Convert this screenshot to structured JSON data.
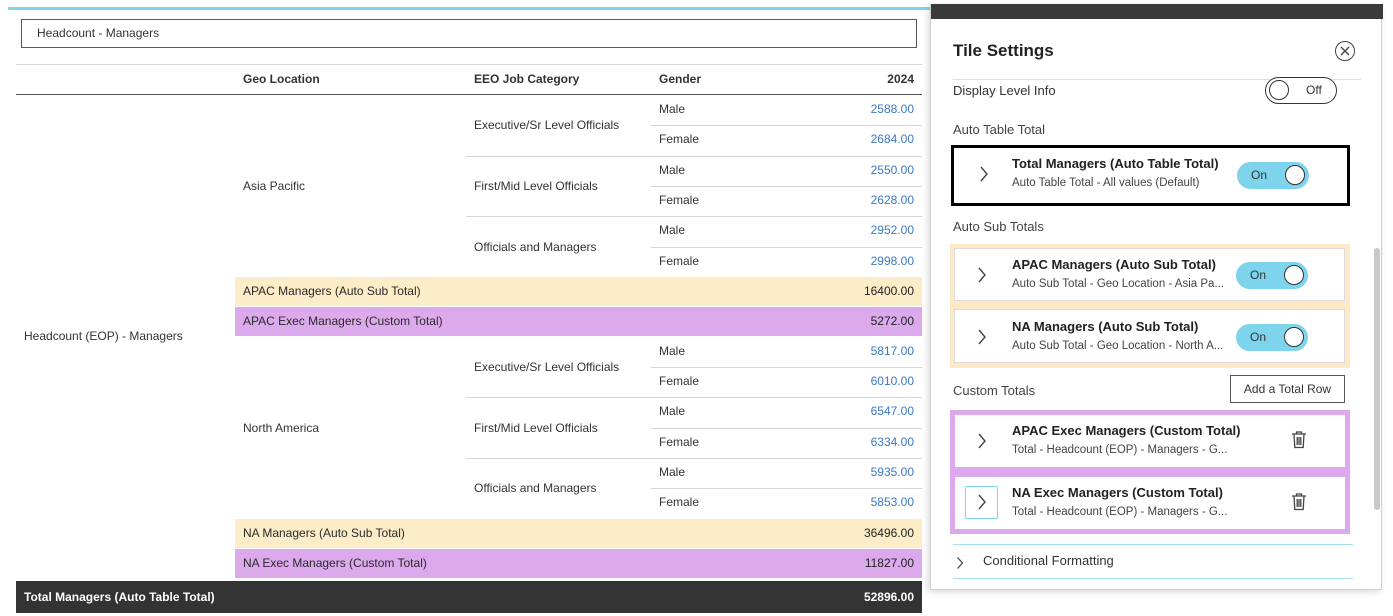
{
  "tile_title": "Headcount - Managers",
  "table": {
    "headers": {
      "geo": "Geo Location",
      "eeo": "EEO Job Category",
      "gender": "Gender",
      "year": "2024"
    },
    "row_group_label": "Headcount (EOP) - Managers",
    "regions": [
      {
        "name": "Asia Pacific",
        "categories": [
          {
            "name": "Executive/Sr Level Officials",
            "rows": [
              {
                "gender": "Male",
                "value": "2588.00"
              },
              {
                "gender": "Female",
                "value": "2684.00"
              }
            ]
          },
          {
            "name": "First/Mid Level Officials",
            "rows": [
              {
                "gender": "Male",
                "value": "2550.00"
              },
              {
                "gender": "Female",
                "value": "2628.00"
              }
            ]
          },
          {
            "name": "Officials and Managers",
            "rows": [
              {
                "gender": "Male",
                "value": "2952.00"
              },
              {
                "gender": "Female",
                "value": "2998.00"
              }
            ]
          }
        ],
        "sub_total": {
          "label": "APAC Managers (Auto Sub Total)",
          "value": "16400.00"
        },
        "custom_total": {
          "label": "APAC Exec Managers (Custom Total)",
          "value": "5272.00"
        }
      },
      {
        "name": "North America",
        "categories": [
          {
            "name": "Executive/Sr Level Officials",
            "rows": [
              {
                "gender": "Male",
                "value": "5817.00"
              },
              {
                "gender": "Female",
                "value": "6010.00"
              }
            ]
          },
          {
            "name": "First/Mid Level Officials",
            "rows": [
              {
                "gender": "Male",
                "value": "6547.00"
              },
              {
                "gender": "Female",
                "value": "6334.00"
              }
            ]
          },
          {
            "name": "Officials and Managers",
            "rows": [
              {
                "gender": "Male",
                "value": "5935.00"
              },
              {
                "gender": "Female",
                "value": "5853.00"
              }
            ]
          }
        ],
        "sub_total": {
          "label": "NA Managers (Auto Sub Total)",
          "value": "36496.00"
        },
        "custom_total": {
          "label": "NA Exec Managers (Custom Total)",
          "value": "11827.00"
        }
      }
    ],
    "grand_total": {
      "label": "Total Managers (Auto Table Total)",
      "value": "52896.00"
    }
  },
  "panel": {
    "title": "Tile Settings",
    "display_level_info": {
      "label": "Display Level Info",
      "state": "Off"
    },
    "auto_table_total": {
      "section": "Auto Table Total",
      "item": {
        "title": "Total Managers (Auto Table Total)",
        "subtitle": "Auto Table Total - All values (Default)",
        "state": "On"
      }
    },
    "auto_sub_totals": {
      "section": "Auto Sub Totals",
      "items": [
        {
          "title": "APAC Managers (Auto Sub Total)",
          "subtitle": "Auto Sub Total - Geo Location - Asia Pa...",
          "state": "On"
        },
        {
          "title": "NA Managers (Auto Sub Total)",
          "subtitle": "Auto Sub Total - Geo Location - North A...",
          "state": "On"
        }
      ]
    },
    "custom_totals": {
      "section": "Custom Totals",
      "add_button": "Add a Total Row",
      "items": [
        {
          "title": "APAC Exec Managers (Custom Total)",
          "subtitle": "Total - Headcount (EOP) - Managers - G..."
        },
        {
          "title": "NA Exec Managers (Custom Total)",
          "subtitle": "Total - Headcount (EOP) - Managers - G..."
        }
      ]
    },
    "conditional_formatting": "Conditional Formatting"
  },
  "colors": {
    "accent": "#7ad6ec",
    "sub_total_band": "#fdecc8",
    "custom_total_band": "#dcaaec",
    "grand_total_band": "#333333",
    "value_link": "#3a79c2",
    "toggle_on": "#7dd4ec"
  },
  "icons": [
    "close-icon",
    "chevron-right-icon",
    "trash-icon"
  ]
}
